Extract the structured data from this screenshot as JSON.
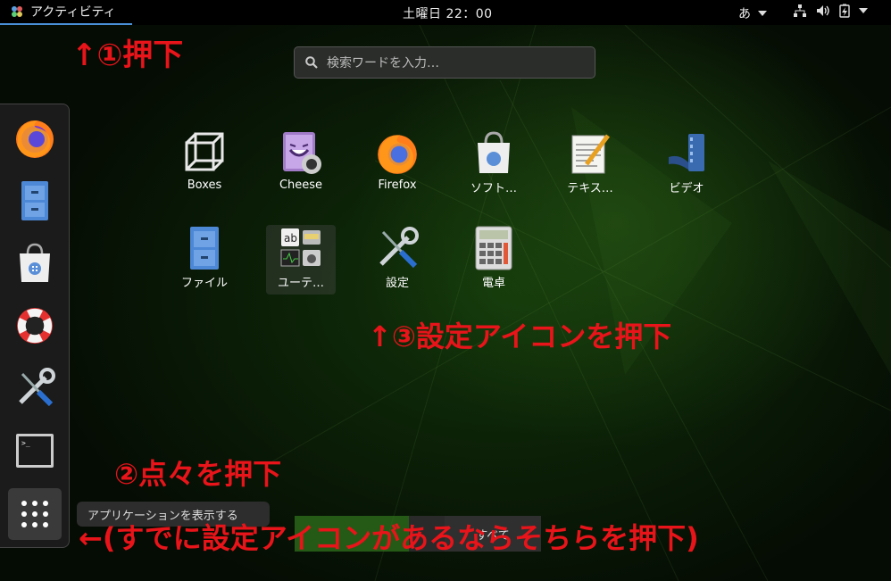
{
  "topbar": {
    "activities_label": "アクティビティ",
    "clock": "土曜日 22：00",
    "input_method": "あ"
  },
  "search": {
    "placeholder": "検索ワードを入力…"
  },
  "dash": {
    "items": [
      "firefox-icon",
      "files-icon",
      "software-icon",
      "help-icon",
      "settings-icon",
      "terminal-icon"
    ],
    "show_apps_tooltip": "アプリケーションを表示する"
  },
  "apps": [
    {
      "label": "Boxes",
      "icon": "boxes-icon"
    },
    {
      "label": "Cheese",
      "icon": "cheese-icon"
    },
    {
      "label": "Firefox",
      "icon": "firefox-icon"
    },
    {
      "label": "ソフト…",
      "icon": "software-icon"
    },
    {
      "label": "テキス…",
      "icon": "text-editor-icon"
    },
    {
      "label": "ビデオ",
      "icon": "video-icon"
    },
    {
      "label": "ファイル",
      "icon": "files-icon"
    },
    {
      "label": "ユーテ…",
      "icon": "utilities-folder-icon"
    },
    {
      "label": "設定",
      "icon": "settings-icon"
    },
    {
      "label": "電卓",
      "icon": "calculator-icon"
    }
  ],
  "bottom_tabs": {
    "all_label": "すべて"
  },
  "annotations": {
    "a1": "↑①押下",
    "a2": "↑③設定アイコンを押下",
    "a3": "②点々を押下",
    "a4": "←(すでに設定アイコンがあるならそちらを押下)"
  },
  "colors": {
    "annotation": "#e8141a",
    "accent": "#4a90d9"
  }
}
